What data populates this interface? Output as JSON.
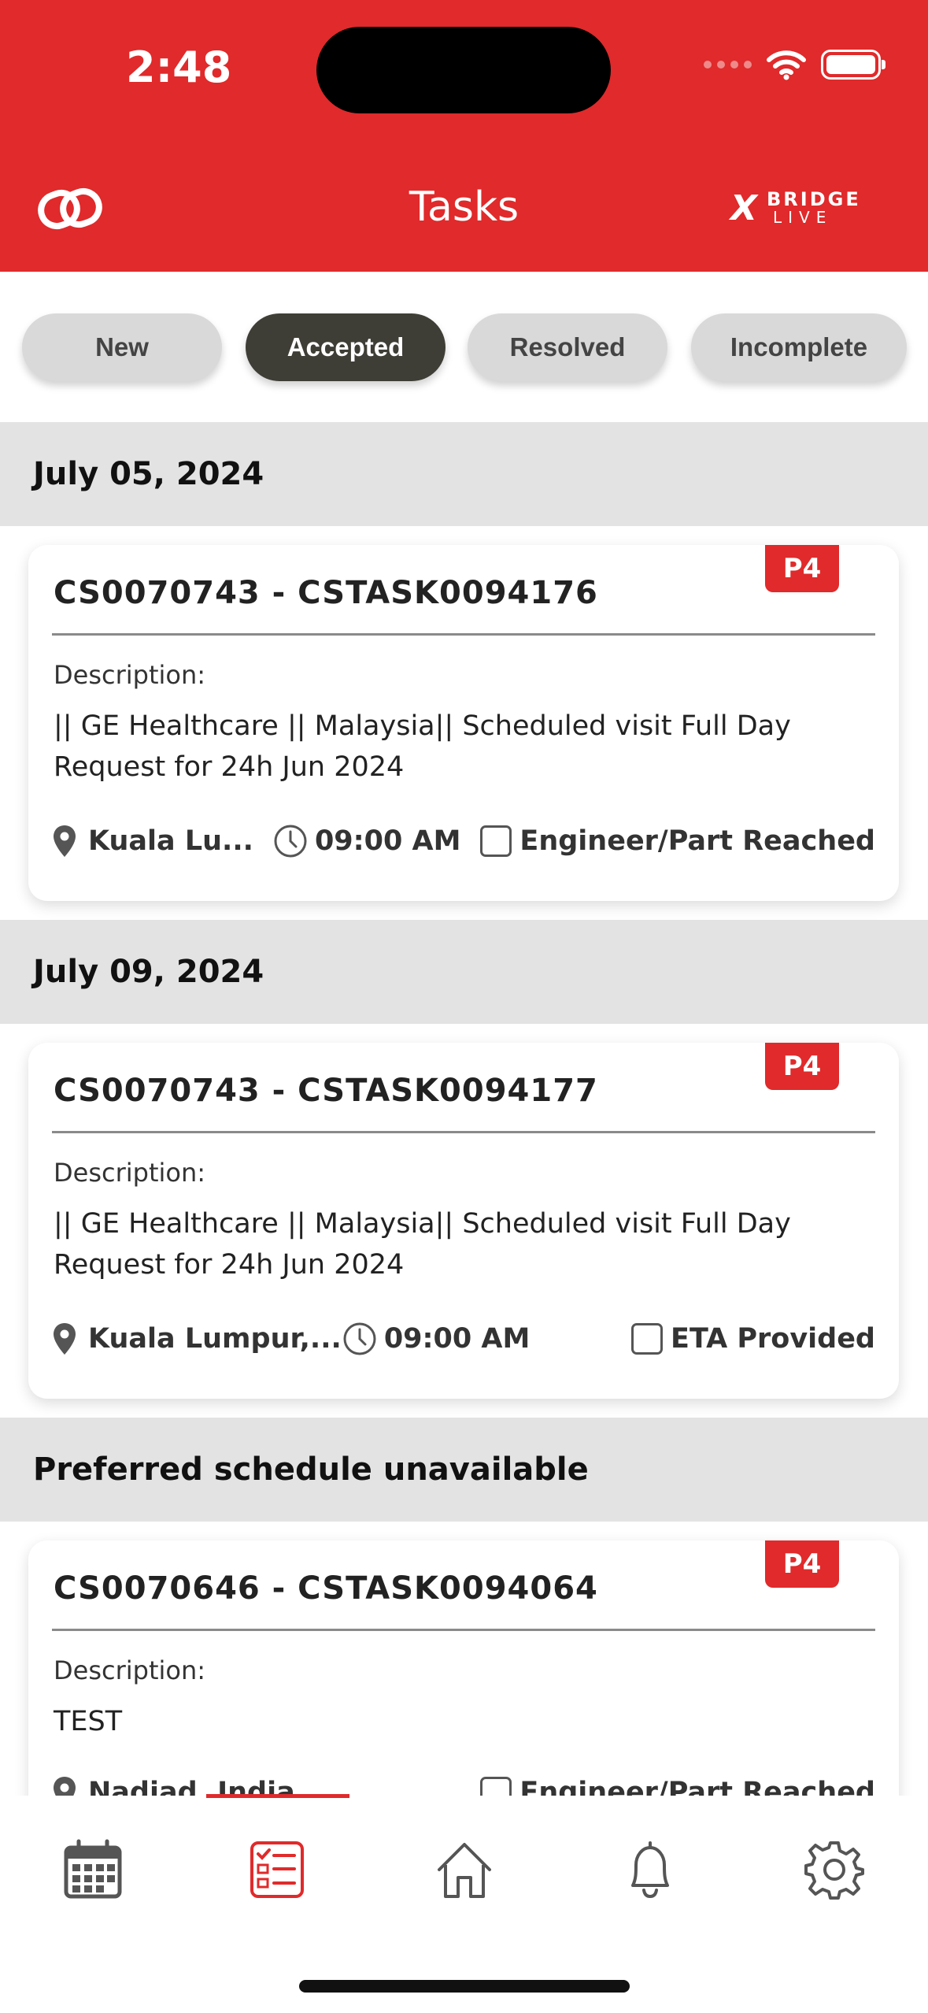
{
  "status_bar": {
    "time": "2:48"
  },
  "header": {
    "title": "Tasks",
    "brand_logo": {
      "mark": "X",
      "line1": "BRIDGE",
      "line2": "LIVE"
    }
  },
  "tabs": [
    {
      "label": "New",
      "active": false
    },
    {
      "label": "Accepted",
      "active": true
    },
    {
      "label": "Resolved",
      "active": false
    },
    {
      "label": "Incomplete",
      "active": false
    }
  ],
  "sections": [
    {
      "date": "July 05, 2024",
      "card": {
        "priority": "P4",
        "title": "CS0070743 - CSTASK0094176",
        "description_label": "Description:",
        "description": "|| GE Healthcare || Malaysia|| Scheduled visit Full Day Request for 24h Jun 2024",
        "location": "Kuala Lu...",
        "time": "09:00 AM",
        "status_label": "Engineer/Part Reached"
      }
    },
    {
      "date": "July 09, 2024",
      "card": {
        "priority": "P4",
        "title": "CS0070743 - CSTASK0094177",
        "description_label": "Description:",
        "description": "|| GE Healthcare || Malaysia|| Scheduled visit Full Day Request for 24h Jun 2024",
        "location": "Kuala Lumpur,...",
        "time": "09:00 AM",
        "status_label": "ETA Provided"
      }
    },
    {
      "date": "Preferred schedule unavailable",
      "card": {
        "priority": "P4",
        "title": "CS0070646 - CSTASK0094064",
        "description_label": "Description:",
        "description": "TEST",
        "location": "Nadiad, India",
        "time": "",
        "status_label": "Engineer/Part Reached"
      }
    }
  ],
  "bottom_nav": {
    "items": [
      {
        "icon": "calendar-icon",
        "active": false
      },
      {
        "icon": "tasks-icon",
        "active": true
      },
      {
        "icon": "home-icon",
        "active": false
      },
      {
        "icon": "bell-icon",
        "active": false
      },
      {
        "icon": "gear-icon",
        "active": false
      }
    ]
  },
  "colors": {
    "brand_red": "#e02a2b",
    "active_tab": "#3f3e36",
    "section_bg": "#e3e3e3",
    "icon_gray": "#555555"
  }
}
